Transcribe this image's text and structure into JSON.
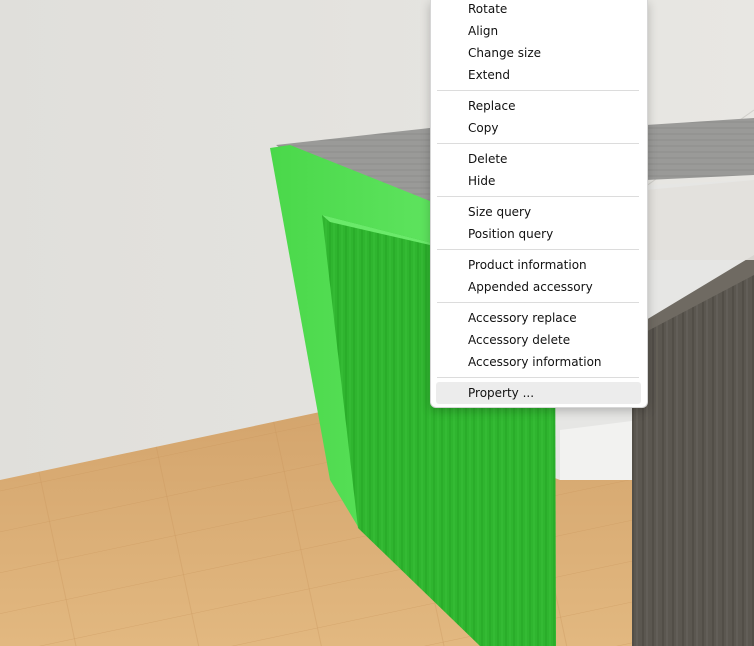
{
  "context_menu": {
    "items": [
      {
        "label": "Rotate"
      },
      {
        "label": "Align"
      },
      {
        "label": "Change size"
      },
      {
        "label": "Extend"
      },
      {
        "label": "Replace"
      },
      {
        "label": "Copy"
      },
      {
        "label": "Delete"
      },
      {
        "label": "Hide"
      },
      {
        "label": "Size query"
      },
      {
        "label": "Position query"
      },
      {
        "label": "Product information"
      },
      {
        "label": "Appended accessory"
      },
      {
        "label": "Accessory replace"
      },
      {
        "label": "Accessory delete"
      },
      {
        "label": "Accessory information"
      },
      {
        "label": "Property ..."
      }
    ],
    "hovered_item": "Property ..."
  },
  "scene": {
    "wall_color": "#e4e3df",
    "floor_color": "#d9ac74",
    "selected_highlight_color": "#3fcc3f",
    "dark_panel_color": "#5a5650"
  }
}
